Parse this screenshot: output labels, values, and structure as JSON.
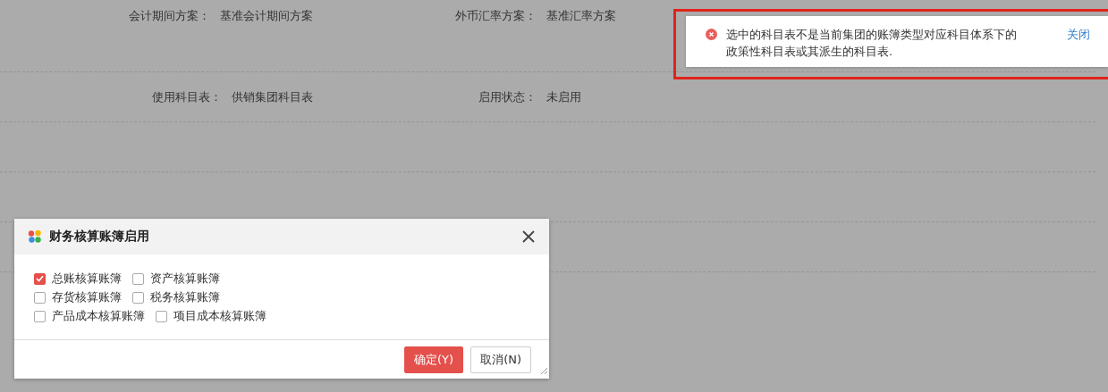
{
  "form": {
    "rows": [
      {
        "fields": [
          {
            "label": "会计期间方案：",
            "value": "基准会计期间方案"
          },
          {
            "label": "外币汇率方案：",
            "value": "基准汇率方案"
          }
        ]
      },
      {
        "fields": [
          {
            "label": "使用科目表：",
            "value": "供销集团科目表"
          },
          {
            "label": "启用状态：",
            "value": "未启用"
          }
        ]
      }
    ]
  },
  "dialog": {
    "title": "财务核算账簿启用",
    "options": [
      [
        {
          "label": "总账核算账簿",
          "checked": true
        },
        {
          "label": "资产核算账簿",
          "checked": false
        }
      ],
      [
        {
          "label": "存货核算账簿",
          "checked": false
        },
        {
          "label": "税务核算账簿",
          "checked": false
        }
      ],
      [
        {
          "label": "产品成本核算账簿",
          "checked": false
        },
        {
          "label": "项目成本核算账簿",
          "checked": false
        }
      ]
    ],
    "buttons": [
      {
        "label": "确定(Y)",
        "kind": "primary"
      },
      {
        "label": "取消(N)",
        "kind": "secondary"
      }
    ]
  },
  "toast": {
    "kind": "error",
    "message": "选中的科目表不是当前集团的账簿类型对应科目体系下的政策性科目表或其派生的科目表.",
    "close": "关闭",
    "highlighted": true
  }
}
